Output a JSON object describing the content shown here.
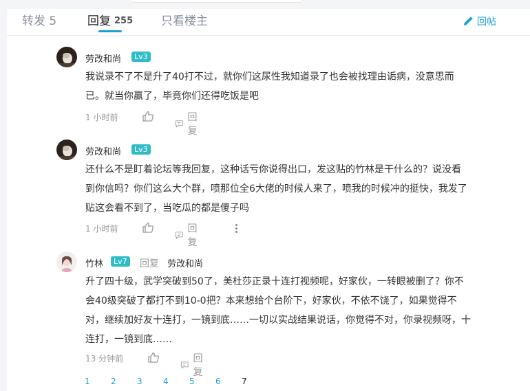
{
  "tabs": {
    "forward": "转发 5",
    "replies": "回复",
    "replies_count": "255",
    "op_only": "只看楼主"
  },
  "reply_button": "回帖",
  "comments": [
    {
      "user": "劳改和尚",
      "level": "Lv3",
      "text_lines": [
        "我说录不了不是升了40打不过，就你们这尿性我知道录了也会被找理由诟病，没意思而",
        "已。就当你赢了，毕竟你们还得吃饭是吧"
      ],
      "time": "1 小时前",
      "reply_label": "回复"
    },
    {
      "user": "劳改和尚",
      "level": "Lv3",
      "text_lines": [
        "还什么不是盯着论坛等我回复，这种话亏你说得出口，发这贴的竹林是干什么的？说没看",
        "到你信吗？你们这么大个群，喷那位全6大佬的时候人来了，喷我的时候冲的挺快，我发了",
        "贴这会看不到了，当吃瓜的都是傻子吗"
      ],
      "time": "1 小时前",
      "reply_label": "回复"
    },
    {
      "user": "竹林",
      "level": "Lv7",
      "reply_word": "回复",
      "reply_to": "劳改和尚",
      "text_lines": [
        "升了四十级，武学突破到50了，美杜莎正录十连打视频呢，好家伙，一转眼被删了？你不",
        "会40级突破了都打不到10-0把？本来想给个台阶下，好家伙，不依不饶了，如果觉得不",
        "对，继续加好友十连打，一镜到底……一切以实战结果说话，你觉得不对，你录视频呀，十",
        "连打，一镜到底……"
      ],
      "time": "13 分钟前",
      "reply_label": "回复"
    }
  ],
  "pagination": [
    "1",
    "2",
    "3",
    "4",
    "5",
    "6",
    "7"
  ],
  "current_page": "7",
  "colors": {
    "accent": "#1a9fd8",
    "level_badge": "#2fbcc6",
    "text": "#333333",
    "muted": "#999999"
  }
}
